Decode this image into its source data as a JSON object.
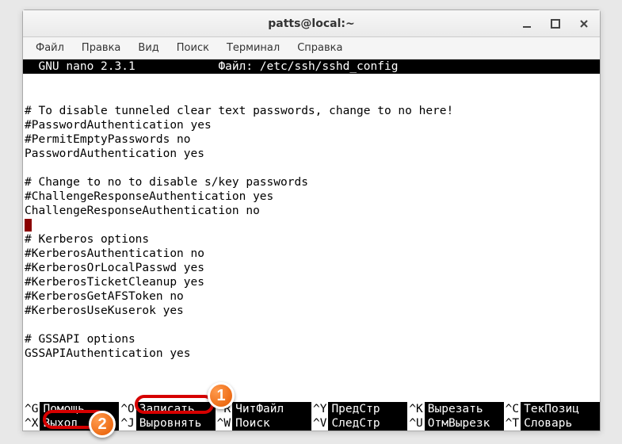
{
  "window": {
    "title": "patts@local:~"
  },
  "menubar": {
    "items": [
      "Файл",
      "Правка",
      "Вид",
      "Поиск",
      "Терминал",
      "Справка"
    ]
  },
  "nano": {
    "header_left": "  GNU nano 2.3.1",
    "header_center": "Файл: /etc/ssh/sshd_config",
    "body_lines": [
      "",
      "",
      "# To disable tunneled clear text passwords, change to no here!",
      "#PasswordAuthentication yes",
      "#PermitEmptyPasswords no",
      "PasswordAuthentication yes",
      "",
      "# Change to no to disable s/key passwords",
      "#ChallengeResponseAuthentication yes",
      "ChallengeResponseAuthentication no",
      "",
      "# Kerberos options",
      "#KerberosAuthentication no",
      "#KerberosOrLocalPasswd yes",
      "#KerberosTicketCleanup yes",
      "#KerberosGetAFSToken no",
      "#KerberosUseKuserok yes",
      "",
      "# GSSAPI options",
      "GSSAPIAuthentication yes"
    ],
    "shortcuts_row1": [
      {
        "key": "^G",
        "label": "Помощь"
      },
      {
        "key": "^O",
        "label": "Записать"
      },
      {
        "key": "^R",
        "label": "ЧитФайл"
      },
      {
        "key": "^Y",
        "label": "ПредСтр"
      },
      {
        "key": "^K",
        "label": "Вырезать"
      },
      {
        "key": "^C",
        "label": "ТекПозиц"
      }
    ],
    "shortcuts_row2": [
      {
        "key": "^X",
        "label": "Выход"
      },
      {
        "key": "^J",
        "label": "Выровнять"
      },
      {
        "key": "^W",
        "label": "Поиск"
      },
      {
        "key": "^V",
        "label": "СледСтр"
      },
      {
        "key": "^U",
        "label": "ОтмВырезк"
      },
      {
        "key": "^T",
        "label": "Словарь"
      }
    ]
  },
  "callouts": {
    "badge1": "1",
    "badge2": "2"
  }
}
